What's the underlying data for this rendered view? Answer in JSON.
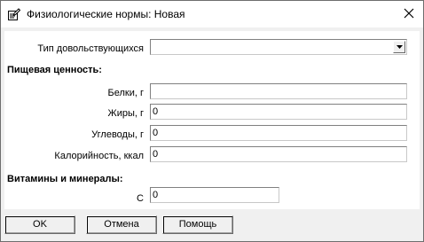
{
  "window": {
    "title": "Физиологические нормы: Новая",
    "icon": "edit-document-icon",
    "close_glyph": "✕"
  },
  "form": {
    "type_label": "Тип довольствующихся",
    "type_value": "",
    "nutrition_section": "Пищевая ценность:",
    "proteins_label": "Белки, г",
    "proteins_value": "",
    "fats_label": "Жиры, г",
    "fats_value": "0",
    "carbs_label": "Углеводы, г",
    "carbs_value": "0",
    "calories_label": "Калорийность, ккал",
    "calories_value": "0",
    "vitamins_section": "Витамины и минералы:",
    "vitamin_c_label": "С",
    "vitamin_c_value": "0"
  },
  "buttons": {
    "ok": "OK",
    "cancel": "Отмена",
    "help": "Помощь"
  }
}
